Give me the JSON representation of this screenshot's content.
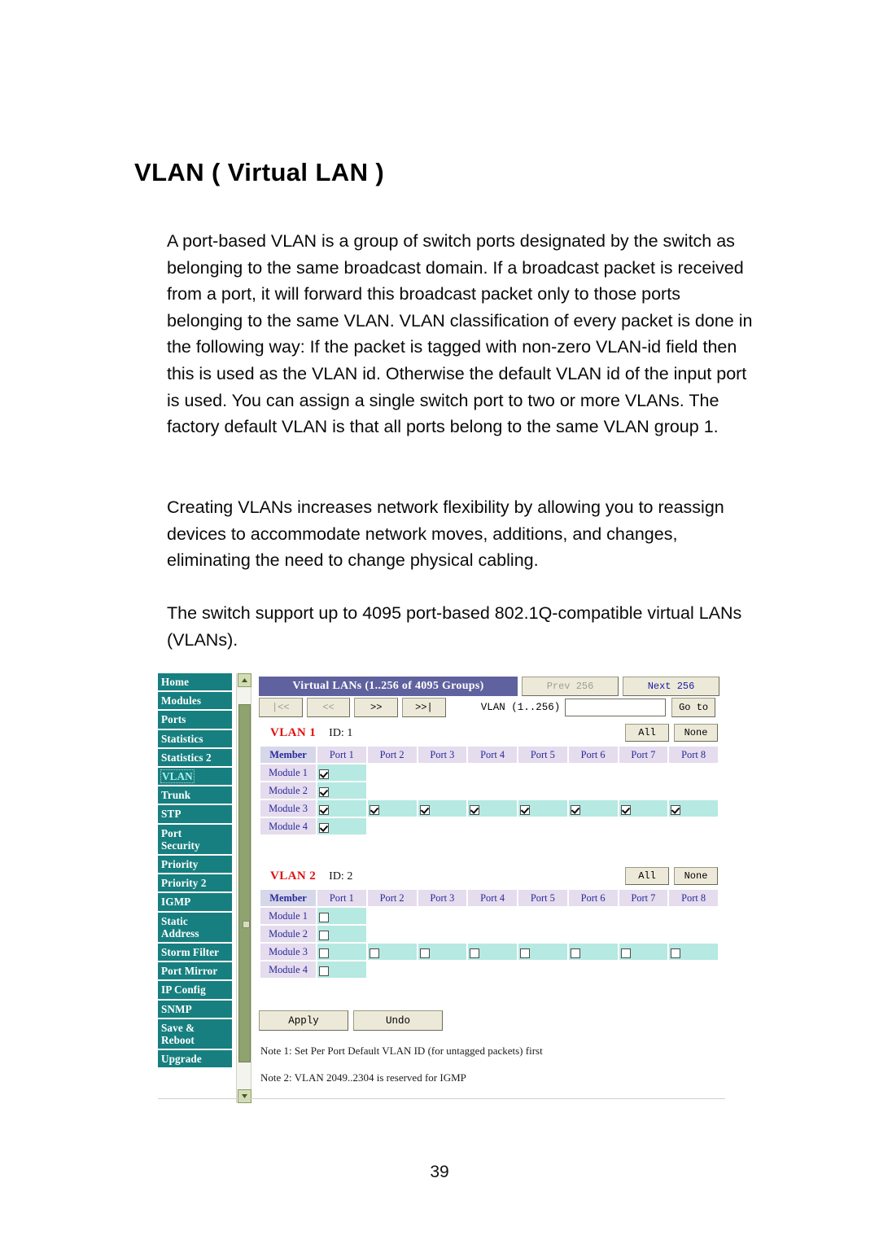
{
  "document": {
    "title": "VLAN ( Virtual LAN )",
    "paragraphs": [
      "A port-based VLAN is a group of switch ports designated by the switch as belonging to the same broadcast domain. If a broadcast packet is received from a port, it will forward this broadcast packet only to those ports belonging to the same VLAN. VLAN classification of every packet is done in the following way: If the packet is tagged with non-zero VLAN-id field then this is used as the VLAN id. Otherwise the default VLAN id of the input port is used. You can assign a single switch port to two or more VLANs. The factory default VLAN is that all ports belong to the same VLAN group 1.",
      "Creating VLANs increases network flexibility by allowing you to reassign devices to accommodate network moves, additions, and changes, eliminating the need to change physical cabling.",
      "The switch support up to 4095 port-based 802.1Q-compatible virtual LANs (VLANs)."
    ],
    "page_number": "39"
  },
  "colors": {
    "sidebar_bg": "#177f7f",
    "sidebar_active_text": "#a8f0ef",
    "title_bar_bg": "#5f629e",
    "vlan_label": "#e01010",
    "header_member_bg": "#d6d7e8",
    "header_port_bg": "#e5dced",
    "cell_active_bg": "#b5e9e2",
    "button_bg": "#ece9d8",
    "scrollbar_thumb": "#8fa370"
  },
  "sidebar": {
    "items": [
      {
        "label": "Home",
        "active": false
      },
      {
        "label": "Modules",
        "active": false
      },
      {
        "label": "Ports",
        "active": false
      },
      {
        "label": "Statistics",
        "active": false
      },
      {
        "label": "Statistics 2",
        "active": false
      },
      {
        "label": "VLAN",
        "active": true
      },
      {
        "label": "Trunk",
        "active": false
      },
      {
        "label": "STP",
        "active": false
      },
      {
        "label": "Port\nSecurity",
        "active": false
      },
      {
        "label": "Priority",
        "active": false
      },
      {
        "label": "Priority 2",
        "active": false
      },
      {
        "label": "IGMP",
        "active": false
      },
      {
        "label": "Static\nAddress",
        "active": false
      },
      {
        "label": "Storm Filter",
        "active": false
      },
      {
        "label": "Port Mirror",
        "active": false
      },
      {
        "label": "IP Config",
        "active": false
      },
      {
        "label": "SNMP",
        "active": false
      },
      {
        "label": "Save &\nReboot",
        "active": false
      },
      {
        "label": "Upgrade",
        "active": false
      }
    ]
  },
  "panel": {
    "title_bar": "Virtual LANs (1..256 of 4095 Groups)",
    "prev_button": "Prev 256",
    "next_button": "Next 256",
    "pager": {
      "first": "|<<",
      "prev": "<<",
      "next": ">>",
      "last": ">>|"
    },
    "goto": {
      "label": "VLAN (1..256)",
      "value": "",
      "placeholder": "",
      "button": "Go to"
    },
    "all_button": "All",
    "none_button": "None",
    "apply_button": "Apply",
    "undo_button": "Undo",
    "notes": [
      "Note 1: Set Per Port Default VLAN ID (for untagged packets) first",
      "Note 2: VLAN 2049..2304 is reserved for IGMP"
    ],
    "columns": [
      "Member",
      "Port 1",
      "Port 2",
      "Port 3",
      "Port 4",
      "Port 5",
      "Port 6",
      "Port 7",
      "Port 8"
    ],
    "vlans": [
      {
        "name": "VLAN 1",
        "id_label": "ID: 1",
        "rows": [
          {
            "label": "Module 1",
            "checks": [
              true,
              false,
              false,
              false,
              false,
              false,
              false,
              false
            ],
            "enabled": [
              true,
              false,
              false,
              false,
              false,
              false,
              false,
              false
            ]
          },
          {
            "label": "Module 2",
            "checks": [
              true,
              false,
              false,
              false,
              false,
              false,
              false,
              false
            ],
            "enabled": [
              true,
              false,
              false,
              false,
              false,
              false,
              false,
              false
            ]
          },
          {
            "label": "Module 3",
            "checks": [
              true,
              true,
              true,
              true,
              true,
              true,
              true,
              true
            ],
            "enabled": [
              true,
              true,
              true,
              true,
              true,
              true,
              true,
              true
            ]
          },
          {
            "label": "Module 4",
            "checks": [
              true,
              false,
              false,
              false,
              false,
              false,
              false,
              false
            ],
            "enabled": [
              true,
              false,
              false,
              false,
              false,
              false,
              false,
              false
            ]
          }
        ]
      },
      {
        "name": "VLAN 2",
        "id_label": "ID: 2",
        "rows": [
          {
            "label": "Module 1",
            "checks": [
              false,
              false,
              false,
              false,
              false,
              false,
              false,
              false
            ],
            "enabled": [
              true,
              false,
              false,
              false,
              false,
              false,
              false,
              false
            ]
          },
          {
            "label": "Module 2",
            "checks": [
              false,
              false,
              false,
              false,
              false,
              false,
              false,
              false
            ],
            "enabled": [
              true,
              false,
              false,
              false,
              false,
              false,
              false,
              false
            ]
          },
          {
            "label": "Module 3",
            "checks": [
              false,
              false,
              false,
              false,
              false,
              false,
              false,
              false
            ],
            "enabled": [
              true,
              true,
              true,
              true,
              true,
              true,
              true,
              true
            ]
          },
          {
            "label": "Module 4",
            "checks": [
              false,
              false,
              false,
              false,
              false,
              false,
              false,
              false
            ],
            "enabled": [
              true,
              false,
              false,
              false,
              false,
              false,
              false,
              false
            ]
          }
        ]
      }
    ]
  }
}
